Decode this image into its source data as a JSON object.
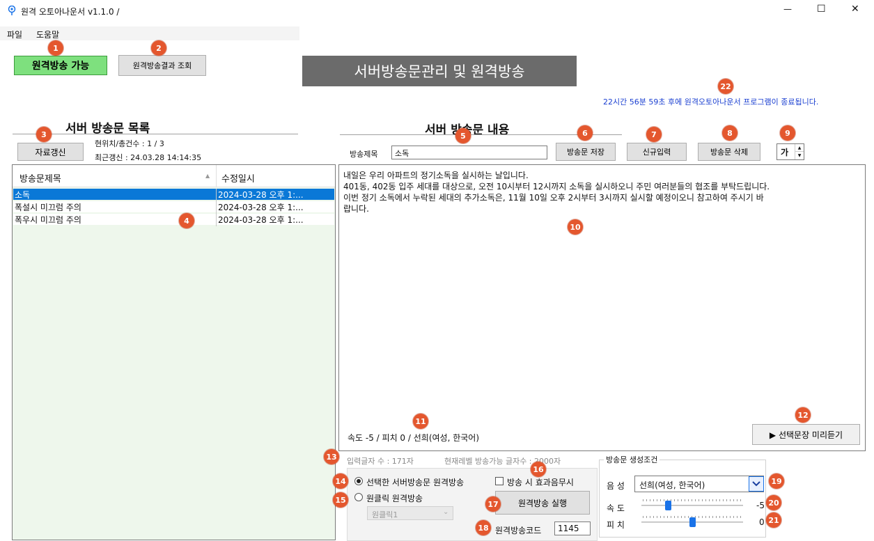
{
  "window": {
    "title": "원격 오토아나운서 v1.1.0  /",
    "controls": {
      "minimize": "—",
      "maximize": "☐",
      "close": "✕"
    }
  },
  "menu": {
    "file": "파일",
    "help": "도움말"
  },
  "top": {
    "status_button": "원격방송 가능",
    "results_button": "원격방송결과 조회",
    "banner_title": "서버방송문관리 및 원격방송",
    "countdown": "22시간 56분 59초 후에 원격오토아나운서 프로그램이 종료됩니다."
  },
  "left": {
    "section_title": "서버 방송문 목록",
    "refresh_button": "자료갱신",
    "position_label": "현위치/총건수 : 1 / 3",
    "last_refresh": "최근갱신 : 24.03.28 14:14:35",
    "columns": {
      "title": "방송문제목",
      "modified": "수정일시"
    },
    "rows": [
      {
        "title": "소독",
        "modified": "2024-03-28 오후 1:..."
      },
      {
        "title": "폭설시 미끄럼 주의",
        "modified": "2024-03-28 오후 1:..."
      },
      {
        "title": "폭우시 미끄럼 주의",
        "modified": "2024-03-28 오후 1:..."
      }
    ]
  },
  "right": {
    "section_title": "서버 방송문 내용",
    "title_label": "방송제목",
    "title_value": "소독",
    "save_button": "방송문 저장",
    "new_button": "신규입력",
    "delete_button": "방송문 삭제",
    "font_button": "가",
    "content_lines": [
      "내일은 우리 아파트의 정기소독을 실시하는 날입니다.",
      "401동, 402동 입주 세대를 대상으로, 오전 10시부터 12시까지 소독을 실시하오니 주민 여러분들의 협조를 부탁드립니다.",
      "이번 정기 소독에서 누락된 세대의 추가소독은, 11월 10일 오후 2시부터 3시까지 실시할 예정이오니 참고하여 주시기 바",
      "랍니다."
    ],
    "voice_status": "속도 -5 / 피치 0 / 선희(여성, 한국어)",
    "preview_button": "▶ 선택문장 미리듣기"
  },
  "bottom": {
    "char_count": "입력글자 수 : 171자",
    "level_limit": "현재레벨 방송가능 글자수 : 2000자",
    "radio_selected_label": "선택한 서버방송문 원격방송",
    "radio_oneclick_label": "원클릭 원격방송",
    "oneclick_select": "원클릭1",
    "mute_effect_label": "방송 시 효과음무시",
    "run_button": "원격방송 실행",
    "code_label": "원격방송코드",
    "code_value": "1145"
  },
  "conditions": {
    "group_title": "방송문 생성조건",
    "voice_label": "음 성",
    "voice_value": "선희(여성, 한국어)",
    "speed_label": "속 도",
    "speed_value": "-5",
    "pitch_label": "피 치",
    "pitch_value": "0",
    "speed_level": -5,
    "pitch_level": 0
  },
  "markers": [
    "1",
    "2",
    "3",
    "4",
    "5",
    "6",
    "7",
    "8",
    "9",
    "10",
    "11",
    "12",
    "13",
    "14",
    "15",
    "16",
    "17",
    "18",
    "19",
    "20",
    "21",
    "22"
  ],
  "colors": {
    "status_green": "#7ee07e",
    "banner_bg": "#6b6b6b",
    "selection_blue": "#0a78d7",
    "list_bg": "#eef7ec",
    "marker": "#e4572e",
    "countdown_blue": "#1a3fd1"
  }
}
